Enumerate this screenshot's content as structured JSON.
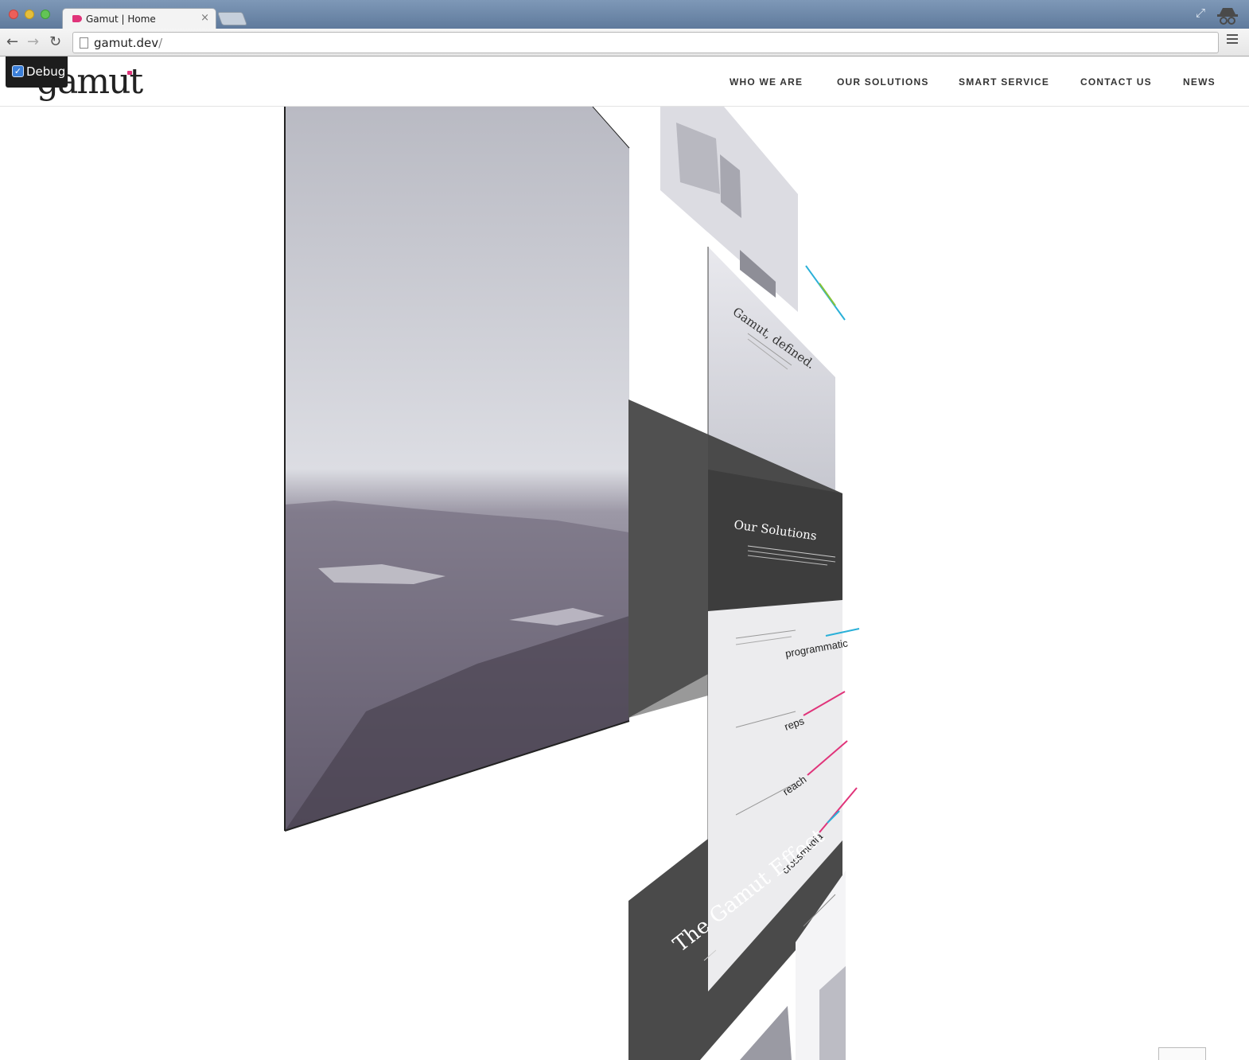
{
  "browser": {
    "tab_title": "Gamut | Home",
    "tab_close": "×",
    "url_host": "gamut.dev",
    "url_path": "/"
  },
  "debug": {
    "label": "Debug",
    "checked": true
  },
  "site": {
    "logo": "gamut",
    "nav": [
      "WHO WE ARE",
      "OUR SOLUTIONS",
      "SMART SERVICE",
      "CONTACT US",
      "NEWS"
    ]
  },
  "panels": {
    "gamut_defined_title": "Gamut, defined.",
    "our_solutions_title": "Our Solutions",
    "products": [
      "programmatic",
      "reps",
      "reach",
      "crossmedia"
    ],
    "gamut_effect_title": "The Gamut Effect"
  },
  "colors": {
    "accent_pink": "#e0347a",
    "accent_cyan": "#2ab0d8",
    "accent_green": "#86c33a",
    "dark_panel": "#4a4a4a"
  }
}
